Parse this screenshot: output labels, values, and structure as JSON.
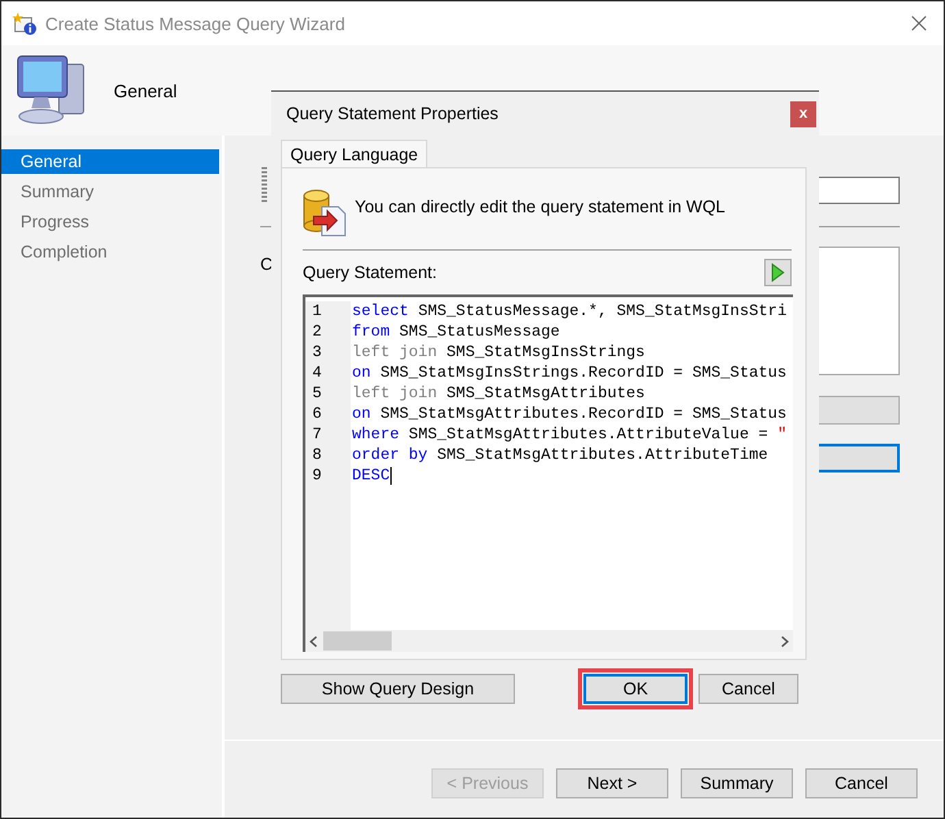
{
  "window": {
    "title": "Create Status Message Query Wizard"
  },
  "header": {
    "title": "General"
  },
  "sidebar": {
    "items": [
      {
        "label": "General",
        "selected": true
      },
      {
        "label": "Summary",
        "selected": false
      },
      {
        "label": "Progress",
        "selected": false
      },
      {
        "label": "Completion",
        "selected": false
      }
    ]
  },
  "background_page": {
    "label": "C"
  },
  "dialog": {
    "title": "Query Statement Properties",
    "close_glyph": "x",
    "tabs": [
      {
        "label": "Query Language",
        "selected": true
      }
    ],
    "info": "You can directly edit the query statement in WQL",
    "editor_label": "Query Statement:",
    "code_lines": [
      {
        "number": "1",
        "caret": false,
        "tokens": [
          {
            "kind": "keyword",
            "text": "select"
          },
          {
            "kind": "plain",
            "text": " SMS_StatusMessage.*, SMS_StatMsgInsStri"
          }
        ]
      },
      {
        "number": "2",
        "caret": false,
        "tokens": [
          {
            "kind": "keyword",
            "text": "from"
          },
          {
            "kind": "plain",
            "text": " SMS_StatusMessage"
          }
        ]
      },
      {
        "number": "3",
        "caret": false,
        "tokens": [
          {
            "kind": "join",
            "text": "left join"
          },
          {
            "kind": "plain",
            "text": " SMS_StatMsgInsStrings"
          }
        ]
      },
      {
        "number": "4",
        "caret": false,
        "tokens": [
          {
            "kind": "keyword",
            "text": "on"
          },
          {
            "kind": "plain",
            "text": " SMS_StatMsgInsStrings.RecordID = SMS_Status"
          }
        ]
      },
      {
        "number": "5",
        "caret": false,
        "tokens": [
          {
            "kind": "join",
            "text": "left join"
          },
          {
            "kind": "plain",
            "text": " SMS_StatMsgAttributes"
          }
        ]
      },
      {
        "number": "6",
        "caret": false,
        "tokens": [
          {
            "kind": "keyword",
            "text": "on"
          },
          {
            "kind": "plain",
            "text": " SMS_StatMsgAttributes.RecordID = SMS_Status"
          }
        ]
      },
      {
        "number": "7",
        "caret": false,
        "tokens": [
          {
            "kind": "keyword",
            "text": "where"
          },
          {
            "kind": "plain",
            "text": " SMS_StatMsgAttributes.AttributeValue = "
          },
          {
            "kind": "string",
            "text": "\""
          }
        ]
      },
      {
        "number": "8",
        "caret": false,
        "tokens": [
          {
            "kind": "keyword",
            "text": "order by"
          },
          {
            "kind": "plain",
            "text": " SMS_StatMsgAttributes.AttributeTime"
          }
        ]
      },
      {
        "number": "9",
        "caret": true,
        "tokens": [
          {
            "kind": "keyword",
            "text": "DESC"
          }
        ]
      }
    ],
    "buttons": [
      {
        "label": "Show Query Design",
        "kind": "wide",
        "highlighted": false,
        "focused": false
      },
      {
        "label": "OK",
        "kind": "normal",
        "highlighted": true,
        "focused": true
      },
      {
        "label": "Cancel",
        "kind": "normal",
        "highlighted": false,
        "focused": false
      }
    ]
  },
  "footer_buttons": [
    {
      "label": "< Previous",
      "disabled": true
    },
    {
      "label": "Next >",
      "disabled": false
    },
    {
      "label": "Summary",
      "disabled": false
    },
    {
      "label": "Cancel",
      "disabled": false
    }
  ]
}
